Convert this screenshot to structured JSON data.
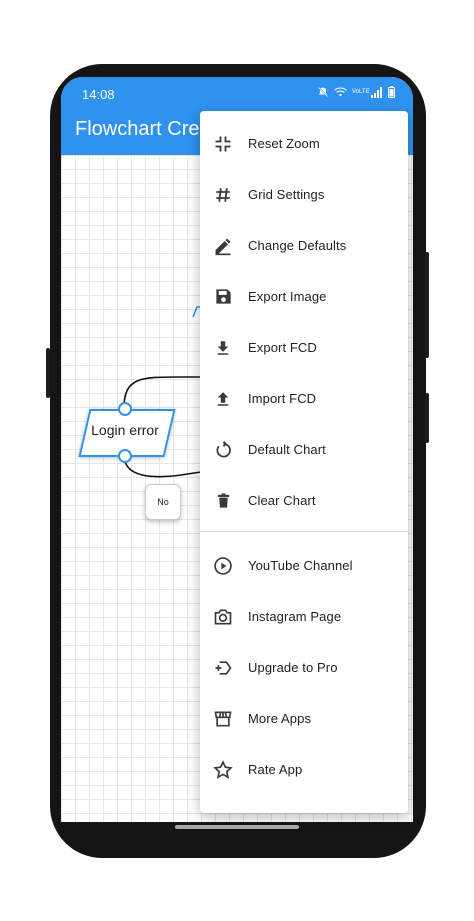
{
  "status_bar": {
    "time": "14:08",
    "icons": [
      "mute-icon",
      "wifi-icon",
      "volte-icon",
      "signal-icon",
      "battery-icon"
    ],
    "volte_label": "VoLTE"
  },
  "app": {
    "title": "Flowchart Cre",
    "accent_color": "#2f92ee"
  },
  "canvas": {
    "shapes": [
      {
        "type": "parallelogram",
        "label": "Login error"
      },
      {
        "type": "label-box",
        "label": "No"
      }
    ]
  },
  "menu": {
    "items": [
      {
        "label": "Reset Zoom",
        "icon": "reset-zoom-icon"
      },
      {
        "label": "Grid Settings",
        "icon": "grid-icon"
      },
      {
        "label": "Change Defaults",
        "icon": "edit-icon"
      },
      {
        "label": "Export Image",
        "icon": "save-icon"
      },
      {
        "label": "Export FCD",
        "icon": "download-icon"
      },
      {
        "label": "Import FCD",
        "icon": "upload-icon"
      },
      {
        "label": "Default Chart",
        "icon": "refresh-icon"
      },
      {
        "label": "Clear Chart",
        "icon": "trash-icon"
      },
      {
        "label": "YouTube Channel",
        "icon": "play-circle-icon"
      },
      {
        "label": "Instagram Page",
        "icon": "camera-icon"
      },
      {
        "label": "Upgrade to Pro",
        "icon": "upgrade-icon"
      },
      {
        "label": "More Apps",
        "icon": "store-icon"
      },
      {
        "label": "Rate App",
        "icon": "star-icon"
      }
    ]
  }
}
